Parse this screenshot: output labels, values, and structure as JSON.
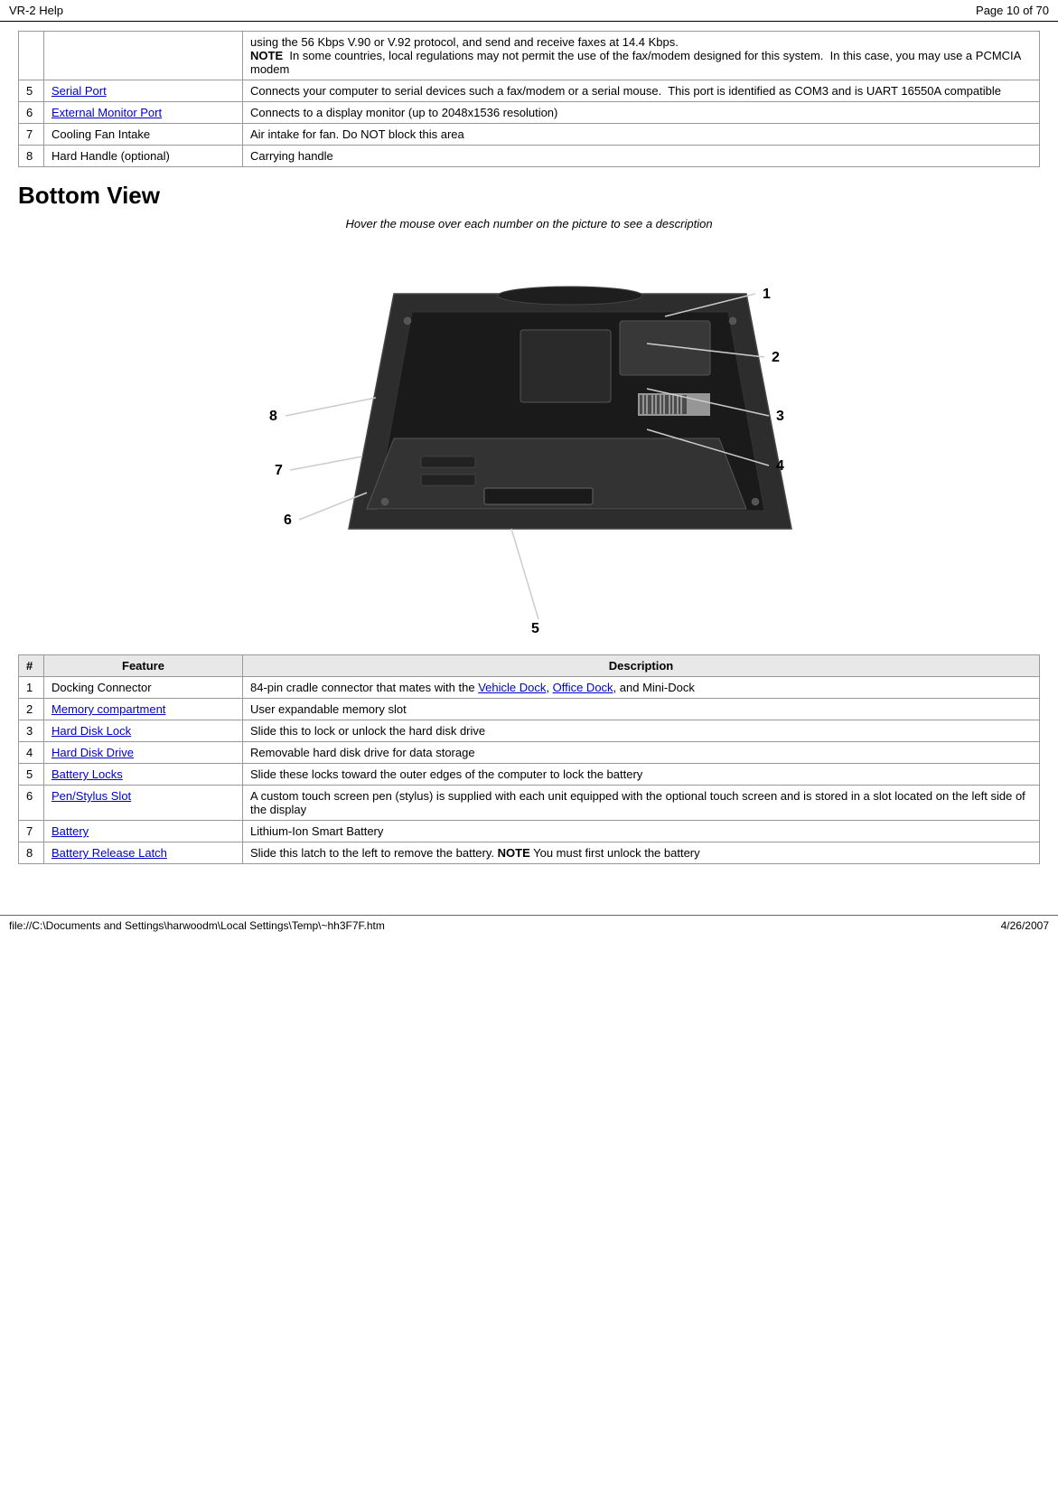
{
  "header": {
    "title": "VR-2 Help",
    "page_info": "Page 10 of 70"
  },
  "top_table": {
    "rows": [
      {
        "num": "",
        "feature": "",
        "description": "using the 56 Kbps V.90 or V.92 protocol, and send and receive faxes at 14.4 Kbps.\nNOTE  In some countries, local regulations may not permit the use of the fax/modem designed for this system.  In this case, you may use a PCMCIA modem"
      },
      {
        "num": "5",
        "feature": "Serial Port",
        "feature_link": true,
        "description": "Connects your computer to serial devices such a fax/modem or a serial mouse.  This port is identified as COM3 and is UART 16550A compatible"
      },
      {
        "num": "6",
        "feature": "External Monitor Port",
        "feature_link": true,
        "description": "Connects to a display monitor (up to 2048x1536 resolution)"
      },
      {
        "num": "7",
        "feature": "Cooling Fan Intake",
        "feature_link": false,
        "description": "Air intake for fan. Do NOT block this area"
      },
      {
        "num": "8",
        "feature": "Hard Handle (optional)",
        "feature_link": false,
        "description": "Carrying handle"
      }
    ]
  },
  "section_title": "Bottom View",
  "image_caption": "Hover the mouse over each number on the picture to see a description",
  "bottom_table": {
    "headers": [
      "#",
      "Feature",
      "Description"
    ],
    "rows": [
      {
        "num": "1",
        "feature": "Docking Connector",
        "feature_link": false,
        "description": "84-pin cradle connector that mates with the Vehicle Dock, Office Dock, and Mini-Dock",
        "desc_links": [
          "Vehicle Dock",
          "Office Dock"
        ]
      },
      {
        "num": "2",
        "feature": "Memory compartment",
        "feature_link": true,
        "description": "User expandable memory slot"
      },
      {
        "num": "3",
        "feature": "Hard Disk Lock",
        "feature_link": true,
        "description": "Slide this to lock or unlock the hard disk drive"
      },
      {
        "num": "4",
        "feature": "Hard Disk Drive",
        "feature_link": true,
        "description": "Removable hard disk drive for data storage"
      },
      {
        "num": "5",
        "feature": "Battery Locks",
        "feature_link": true,
        "description": "Slide these locks toward the outer edges of the computer to lock the battery"
      },
      {
        "num": "6",
        "feature": "Pen/Stylus Slot",
        "feature_link": true,
        "description": "A custom touch screen pen (stylus) is supplied with each unit equipped with the optional touch screen and is stored in a slot located on the left side of the display"
      },
      {
        "num": "7",
        "feature": "Battery",
        "feature_link": true,
        "description": "Lithium-Ion Smart Battery"
      },
      {
        "num": "8",
        "feature": "Battery Release Latch",
        "feature_link": true,
        "description": "Slide this latch to the left to remove the battery. NOTE You must first unlock the battery"
      }
    ]
  },
  "footer": {
    "path": "file://C:\\Documents and Settings\\harwoodm\\Local Settings\\Temp\\~hh3F7F.htm",
    "date": "4/26/2007"
  }
}
